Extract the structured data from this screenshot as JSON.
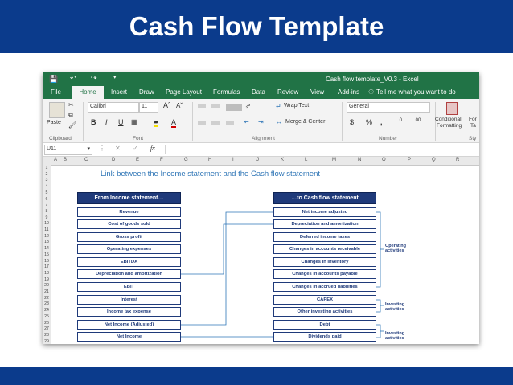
{
  "slide": {
    "title": "Cash Flow Template"
  },
  "excel": {
    "window_title": "Cash flow template_V0.3  -  Excel",
    "tabs": [
      "File",
      "Home",
      "Insert",
      "Draw",
      "Page Layout",
      "Formulas",
      "Data",
      "Review",
      "View",
      "Add-ins"
    ],
    "tell_me": "Tell me what you want to do",
    "ribbon": {
      "clipboard": {
        "label": "Clipboard",
        "paste": "Paste"
      },
      "font": {
        "label": "Font",
        "name": "Calibri",
        "size": "11"
      },
      "alignment": {
        "label": "Alignment",
        "wrap": "Wrap Text",
        "merge": "Merge & Center"
      },
      "number": {
        "label": "Number",
        "format": "General"
      },
      "styles": {
        "cond_fmt": "Conditional",
        "cond_fmt2": "Formatting",
        "format_as": "For",
        "format_as2": "Ta",
        "label": "Sty"
      }
    },
    "name_box": "U11",
    "fx": "fx",
    "columns": [
      "A",
      "B",
      "C",
      "D",
      "E",
      "F",
      "G",
      "H",
      "I",
      "J",
      "K",
      "L",
      "M",
      "N",
      "O",
      "P",
      "Q",
      "R"
    ],
    "rows": [
      "1",
      "2",
      "3",
      "4",
      "5",
      "6",
      "7",
      "8",
      "9",
      "10",
      "11",
      "12",
      "13",
      "14",
      "15",
      "16",
      "17",
      "18",
      "19",
      "20",
      "21",
      "22",
      "23",
      "24",
      "25",
      "26",
      "27",
      "28",
      "29"
    ],
    "sheet": {
      "heading": "Link between the Income statement and the Cash flow statement",
      "left_header": "From Income statement…",
      "right_header": "…to Cash flow statement",
      "left_items": [
        "Revenue",
        "Cost of goods sold",
        "Gross profit",
        "Operating expenses",
        "EBITDA",
        "Depreciation and amortization",
        "EBIT",
        "Interest",
        "Income tax expense",
        "Net Income (Adjusted)",
        "Net Income"
      ],
      "right_items": [
        "Net income adjusted",
        "Depreciation and amortization",
        "Deferred income taxes",
        "Changes in accounts receivable",
        "Changes in inventory",
        "Changes in accounts payable",
        "Changes in accrued liabilities",
        "CAPEX",
        "Other investing activities",
        "Debt",
        "Dividends paid"
      ],
      "groups": {
        "operating": [
          "Operating",
          "activities"
        ],
        "investing": [
          "Investing",
          "activities"
        ],
        "financing": [
          "Investing",
          "activities"
        ]
      }
    }
  }
}
